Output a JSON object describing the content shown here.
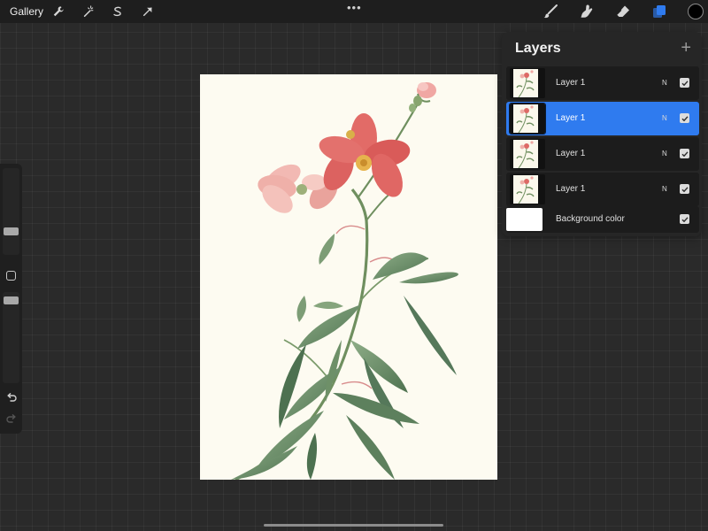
{
  "topbar": {
    "gallery_label": "Gallery",
    "left_tools": [
      "wrench-icon",
      "magic-wand-icon",
      "selection-icon",
      "transform-arrow-icon"
    ],
    "more_label": "•••",
    "right_tools": [
      "brush-icon",
      "smudge-icon",
      "eraser-icon",
      "layers-icon"
    ],
    "current_color": "#000000",
    "active_tool_color": "#2f7bef"
  },
  "sidebar": {
    "brush_size": 0.25,
    "opacity": 0.95
  },
  "layers_panel": {
    "title": "Layers",
    "add_label": "+",
    "layers": [
      {
        "name": "Layer 1",
        "blend": "N",
        "visible": true,
        "selected": false
      },
      {
        "name": "Layer 1",
        "blend": "N",
        "visible": true,
        "selected": true
      },
      {
        "name": "Layer 1",
        "blend": "N",
        "visible": true,
        "selected": false
      },
      {
        "name": "Layer 1",
        "blend": "N",
        "visible": true,
        "selected": false
      }
    ],
    "background": {
      "name": "Background color",
      "color": "#ffffff",
      "visible": true
    }
  }
}
